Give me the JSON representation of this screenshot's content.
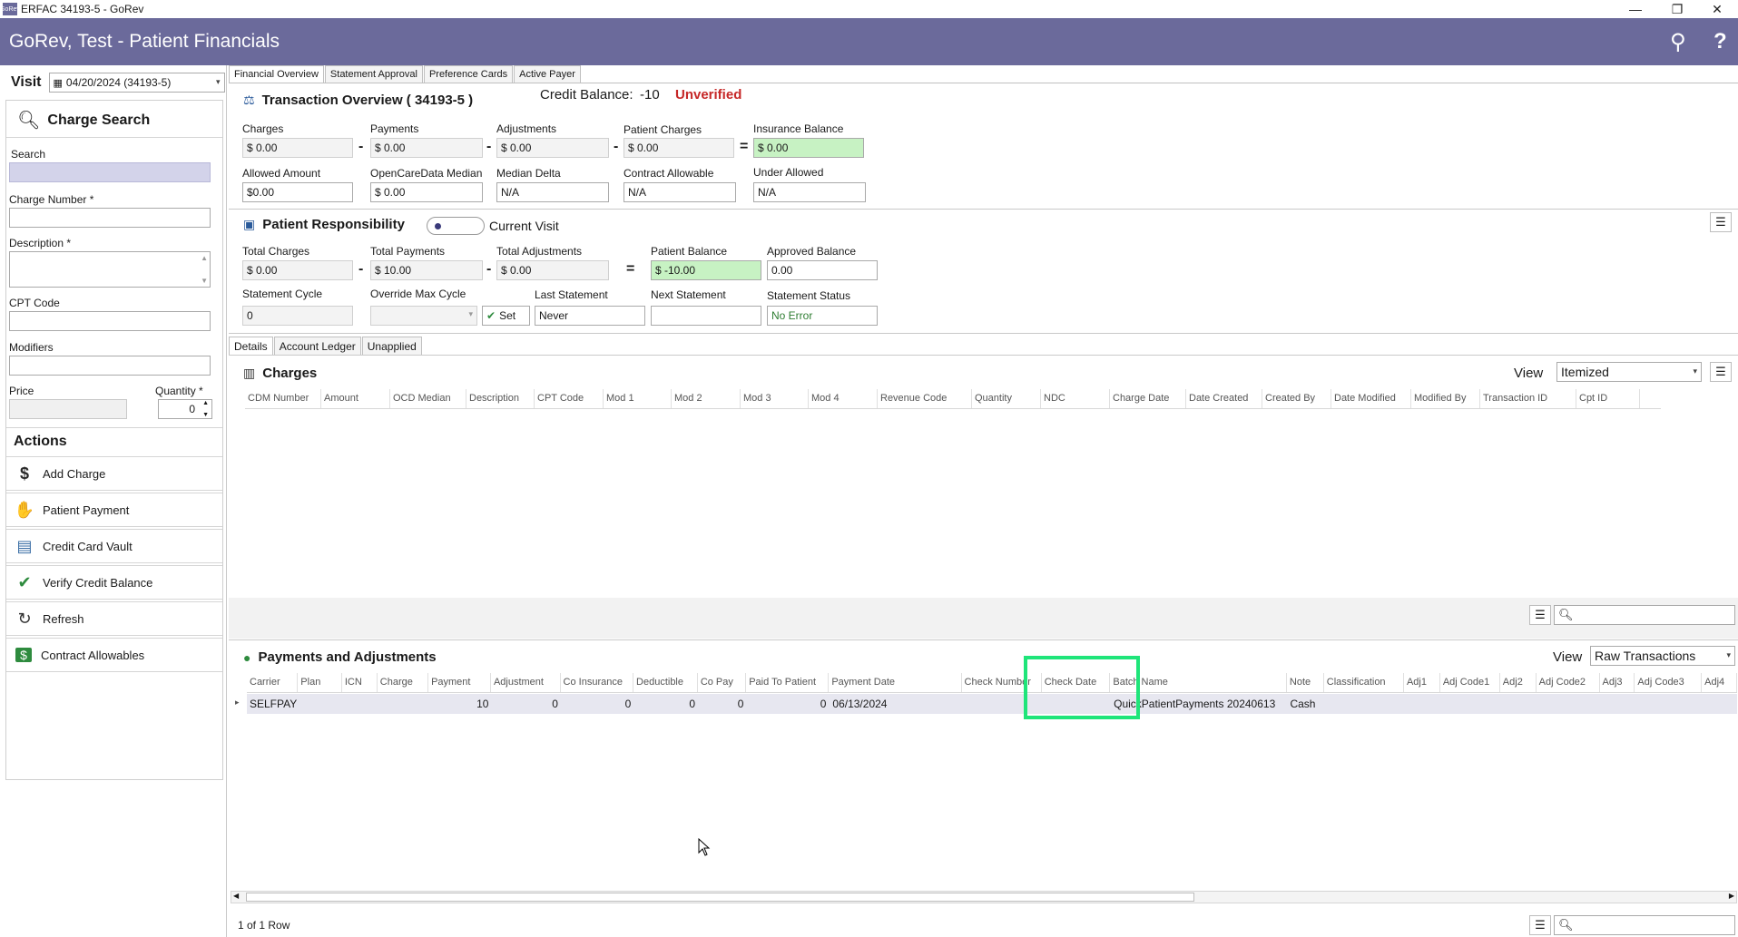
{
  "window": {
    "title": "ERFAC 34193-5 - GoRev",
    "icon_text": "GoRev",
    "minimize": "—",
    "restore": "❐",
    "close": "✕"
  },
  "header": {
    "title": "GoRev, Test - Patient Financials",
    "user_icon": "⚲",
    "help_icon": "?"
  },
  "visit": {
    "label": "Visit",
    "value": "04/20/2024 (34193-5)"
  },
  "charge_search": {
    "title": "Charge Search",
    "search_label": "Search",
    "charge_number_label": "Charge Number *",
    "description_label": "Description *",
    "cpt_label": "CPT Code",
    "modifiers_label": "Modifiers",
    "price_label": "Price",
    "quantity_label": "Quantity *",
    "quantity_value": "0"
  },
  "actions": {
    "title": "Actions",
    "items": [
      {
        "label": "Add Charge",
        "icon": "$"
      },
      {
        "label": "Patient Payment",
        "icon": "✋"
      },
      {
        "label": "Credit Card Vault",
        "icon": "▤"
      },
      {
        "label": "Verify Credit Balance",
        "icon": "✔"
      },
      {
        "label": "Refresh",
        "icon": "↻"
      },
      {
        "label": "Contract Allowables",
        "icon": "$"
      }
    ]
  },
  "tabs": [
    "Financial Overview",
    "Statement Approval",
    "Preference Cards",
    "Active Payer"
  ],
  "credit": {
    "label": "Credit Balance:",
    "value": "-10",
    "status": "Unverified"
  },
  "transaction_overview": {
    "title": "Transaction Overview ( 34193-5 )",
    "charges_label": "Charges",
    "charges_value": "$ 0.00",
    "payments_label": "Payments",
    "payments_value": "$ 0.00",
    "adjustments_label": "Adjustments",
    "adjustments_value": "$ 0.00",
    "patient_charges_label": "Patient Charges",
    "patient_charges_value": "$ 0.00",
    "insurance_balance_label": "Insurance Balance",
    "insurance_balance_value": "$ 0.00",
    "allowed_label": "Allowed Amount",
    "allowed_value": "$0.00",
    "ocd_label": "OpenCareData Median",
    "ocd_value": "$ 0.00",
    "median_delta_label": "Median Delta",
    "median_delta_value": "N/A",
    "contract_label": "Contract Allowable",
    "contract_value": "N/A",
    "under_label": "Under Allowed",
    "under_value": "N/A",
    "minus": "-",
    "equals": "="
  },
  "patient_responsibility": {
    "title": "Patient Responsibility",
    "toggle_label": "Current Visit",
    "total_charges_label": "Total Charges",
    "total_charges_value": "$ 0.00",
    "total_payments_label": "Total Payments",
    "total_payments_value": "$ 10.00",
    "total_adjustments_label": "Total Adjustments",
    "total_adjustments_value": "$ 0.00",
    "patient_balance_label": "Patient Balance",
    "patient_balance_value": "$ -10.00",
    "approved_label": "Approved Balance",
    "approved_value": "0.00",
    "cycle_label": "Statement Cycle",
    "cycle_value": "0",
    "override_label": "Override Max Cycle",
    "set_label": "Set",
    "last_label": "Last Statement",
    "last_value": "Never",
    "next_label": "Next Statement",
    "next_value": "",
    "status_label": "Statement Status",
    "status_value": "No Error"
  },
  "detail_tabs": [
    "Details",
    "Account Ledger",
    "Unapplied"
  ],
  "charges_grid": {
    "title": "Charges",
    "view_label": "View",
    "view_value": "Itemized",
    "columns": [
      "CDM Number",
      "Amount",
      "OCD Median",
      "Description",
      "CPT Code",
      "Mod 1",
      "Mod 2",
      "Mod 3",
      "Mod 4",
      "Revenue Code",
      "Quantity",
      "NDC",
      "Charge Date",
      "Date Created",
      "Created By",
      "Date Modified",
      "Modified By",
      "Transaction ID",
      "Cpt ID"
    ]
  },
  "payments_grid": {
    "title": "Payments and Adjustments",
    "view_label": "View",
    "view_value": "Raw Transactions",
    "columns": [
      "Carrier",
      "Plan",
      "ICN",
      "Charge",
      "Payment",
      "Adjustment",
      "Co Insurance",
      "Deductible",
      "Co Pay",
      "Paid To Patient",
      "Payment Date",
      "Check Number",
      "Check Date",
      "Batch Name",
      "Note",
      "Classification",
      "Adj1",
      "Adj Code1",
      "Adj2",
      "Adj Code2",
      "Adj3",
      "Adj Code3",
      "Adj4"
    ],
    "rows": [
      [
        "SELFPAY",
        "",
        "",
        "",
        "10",
        "0",
        "0",
        "0",
        "0",
        "0",
        "06/13/2024",
        "",
        "",
        "QuickPatientPayments 20240613",
        "Cash",
        "",
        "",
        "",
        "",
        "",
        "",
        "",
        ""
      ]
    ],
    "footer": "1 of 1 Row"
  },
  "colors": {
    "header": "#6b6a9b",
    "highlight_box": "#1fe57a",
    "unverified": "#c62828",
    "no_error": "#2e7d32"
  }
}
